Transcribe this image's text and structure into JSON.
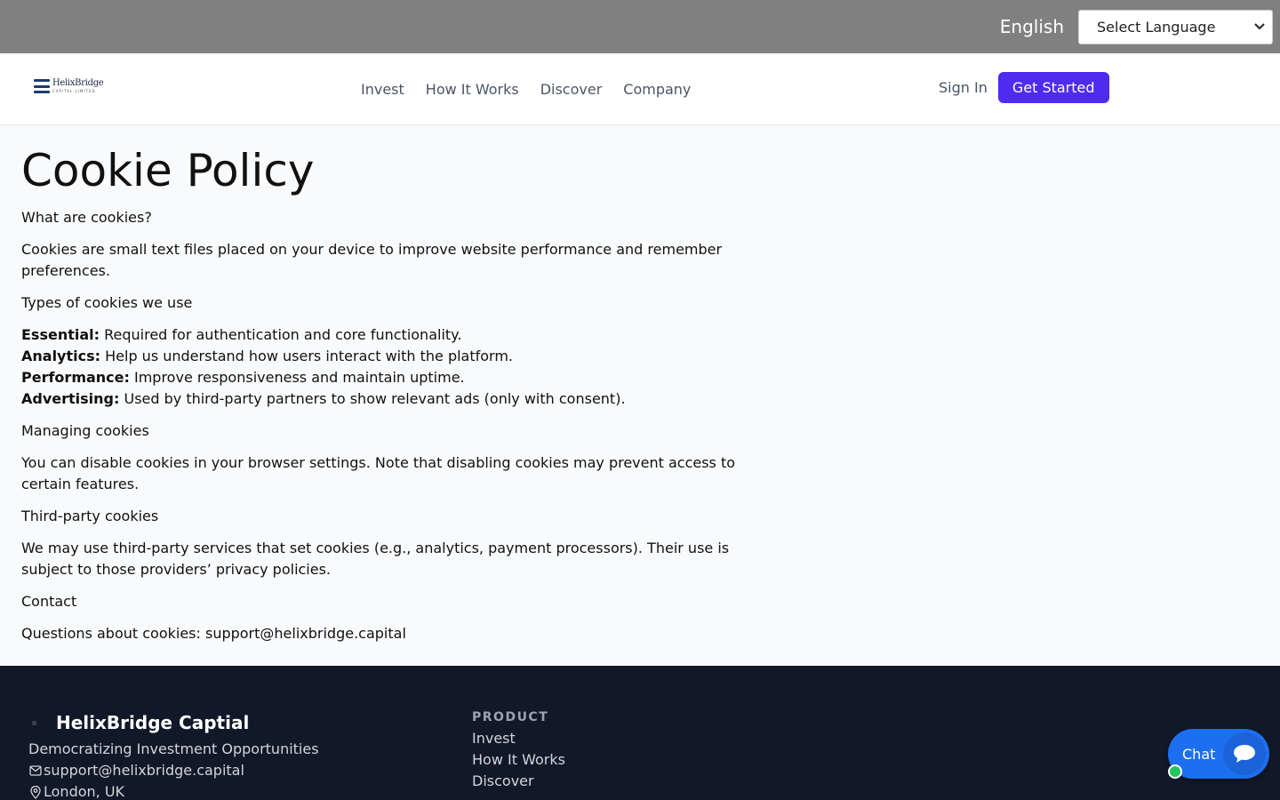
{
  "lang_bar": {
    "current": "English",
    "select_value": "Select Language"
  },
  "brand": {
    "logo_name": "HelixBridge",
    "logo_sub": "CAPITAL LIMITED"
  },
  "nav": {
    "links": [
      "Invest",
      "How It Works",
      "Discover",
      "Company"
    ],
    "signin": "Sign In",
    "cta": "Get Started"
  },
  "page": {
    "title": "Cookie Policy",
    "s1_heading": "What are cookies?",
    "s1_body": "Cookies are small text files placed on your device to improve website performance and remember preferences.",
    "s2_heading": "Types of cookies we use",
    "types": [
      {
        "label": "Essential:",
        "text": " Required for authentication and core functionality."
      },
      {
        "label": "Analytics:",
        "text": " Help us understand how users interact with the platform."
      },
      {
        "label": "Performance:",
        "text": " Improve responsiveness and maintain uptime."
      },
      {
        "label": "Advertising:",
        "text": " Used by third-party partners to show relevant ads (only with consent)."
      }
    ],
    "s3_heading": "Managing cookies",
    "s3_body": "You can disable cookies in your browser settings. Note that disabling cookies may prevent access to certain features.",
    "s4_heading": "Third-party cookies",
    "s4_body": "We may use third-party services that set cookies (e.g., analytics, payment processors). Their use is subject to those providers’ privacy policies.",
    "s5_heading": "Contact",
    "s5_body": "Questions about cookies: support@helixbridge.capital"
  },
  "footer": {
    "brand_title": "HelixBridge Captial",
    "tagline": "Democratizing Investment Opportunities",
    "email": "support@helixbridge.capital",
    "location": "London, UK",
    "product_heading": "PRODUCT",
    "product_links": [
      "Invest",
      "How It Works",
      "Discover"
    ]
  },
  "chat": {
    "label": "Chat"
  },
  "colors": {
    "primary": "#4f2bf0",
    "footer_bg": "#111827",
    "chat": "#1d6ff2",
    "lang_bar": "#808080"
  }
}
